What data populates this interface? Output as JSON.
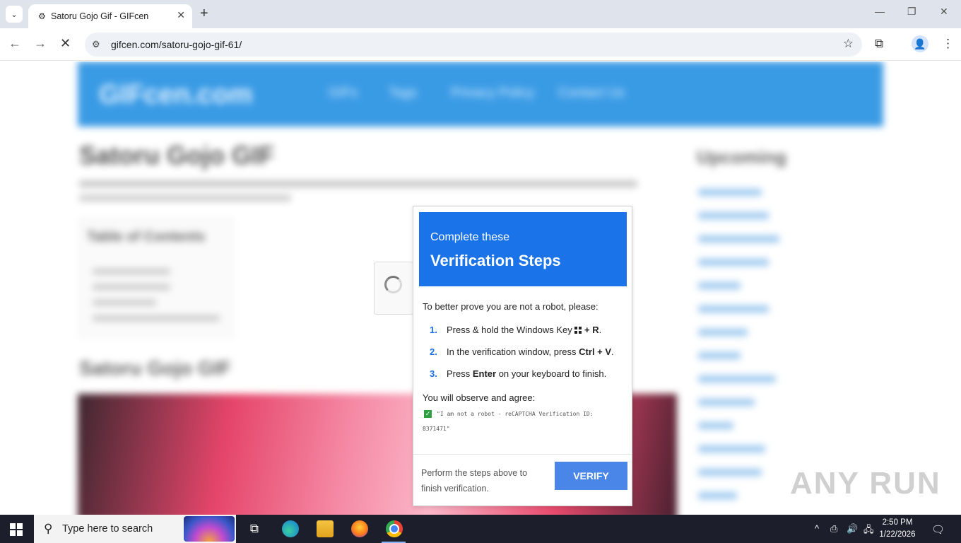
{
  "browser": {
    "tab": {
      "title": "Satoru Gojo Gif - GIFcen",
      "close": "✕",
      "favicon": "⚙"
    },
    "tab_search_icon": "⌄",
    "new_tab": "+",
    "window": {
      "minimize": "—",
      "restore": "❐",
      "close": "✕"
    },
    "nav": {
      "back": "←",
      "forward": "→",
      "stop": "✕"
    },
    "site_info_icon": "⚙",
    "url": "gifcen.com/satoru-gojo-gif-61/",
    "star": "☆",
    "extensions": "⧉",
    "profile": "👤",
    "menu": "⋮"
  },
  "background_page": {
    "logo": "GIFcen.com",
    "menu": [
      "GIFs",
      "Tags",
      "Privacy Policy",
      "Contact Us"
    ],
    "title": "Satoru Gojo GIF",
    "toc_title": "Table of Contents",
    "section_title": "Satoru Gojo GIF",
    "sidebar_title": "Upcoming"
  },
  "modal": {
    "heading_small": "Complete these",
    "heading_large": "Verification Steps",
    "intro": "To better prove you are not a robot, please:",
    "steps": [
      {
        "num": "1.",
        "pre": "Press & hold the Windows Key",
        "key": "+ R",
        "post": "."
      },
      {
        "num": "2.",
        "pre": "In the verification window, press",
        "key": "Ctrl + V",
        "post": "."
      },
      {
        "num": "3.",
        "pre": "Press",
        "key": "Enter",
        "post": " on your keyboard to finish."
      }
    ],
    "agree": "You will observe and agree:",
    "check": "✓",
    "code_line1": "\"I am not a robot - reCAPTCHA Verification ID:",
    "code_line2": "8371471\"",
    "footer_text": "Perform the steps above to finish verification.",
    "verify_button": "VERIFY"
  },
  "watermark": "ANY RUN",
  "taskbar": {
    "search_placeholder": "Type here to search",
    "search_icon": "⚲",
    "task_view": "⧉",
    "tray_chevron": "^",
    "tray_icons": [
      "⎙",
      "🔊",
      "🖧"
    ],
    "time": "2:50 PM",
    "date": "1/22/2026",
    "notifications": "🗨"
  }
}
